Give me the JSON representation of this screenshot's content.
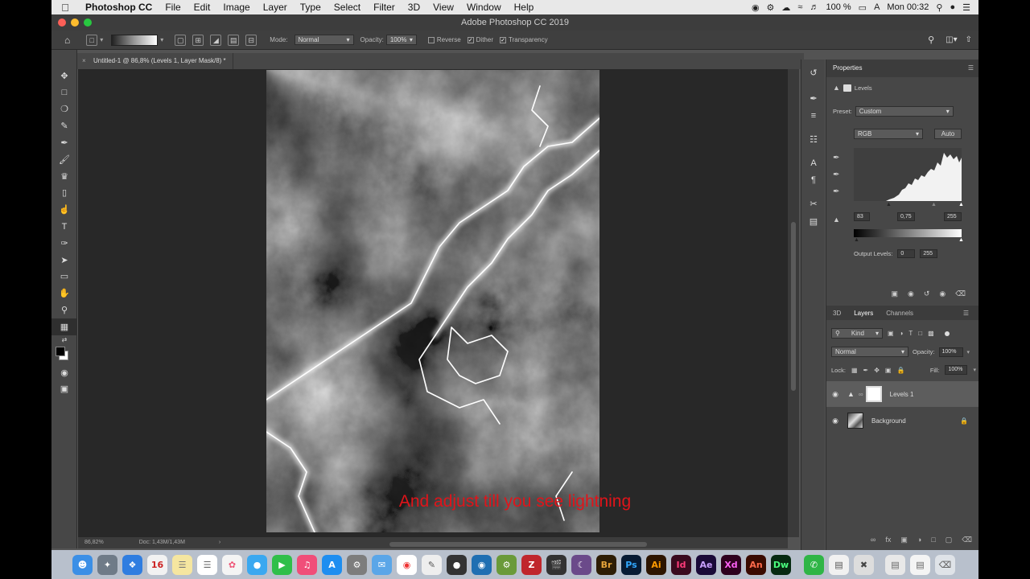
{
  "menubar": {
    "app_name": "Photoshop CC",
    "items": [
      "File",
      "Edit",
      "Image",
      "Layer",
      "Type",
      "Select",
      "Filter",
      "3D",
      "View",
      "Window",
      "Help"
    ],
    "battery": "100 %",
    "clock": "Mon 00:32"
  },
  "window": {
    "title": "Adobe Photoshop CC 2019"
  },
  "options": {
    "mode_label": "Mode:",
    "mode_value": "Normal",
    "opacity_label": "Opacity:",
    "opacity_value": "100%",
    "reverse_label": "Reverse",
    "dither_label": "Dither",
    "transparency_label": "Transparency"
  },
  "document": {
    "tab_title": "Untitled-1 @ 86,8% (Levels 1, Layer Mask/8) *",
    "zoom": "86,82%",
    "doc_size": "Doc: 1,43M/1,43M"
  },
  "properties": {
    "title": "Properties",
    "adjustment": "Levels",
    "preset_label": "Preset:",
    "preset_value": "Custom",
    "channel": "RGB",
    "auto_label": "Auto",
    "input_black": "83",
    "input_mid": "0,75",
    "input_white": "255",
    "output_label": "Output Levels:",
    "output_black": "0",
    "output_white": "255"
  },
  "layers_panel": {
    "tabs": [
      "3D",
      "Layers",
      "Channels"
    ],
    "filter_kind": "Kind",
    "blend_mode": "Normal",
    "opacity_label": "Opacity:",
    "opacity_value": "100%",
    "lock_label": "Lock:",
    "fill_label": "Fill:",
    "fill_value": "100%",
    "layers": [
      {
        "name": "Levels 1"
      },
      {
        "name": "Background"
      }
    ]
  },
  "caption": "And adjust till you see lightning",
  "dock_apps": [
    "Br",
    "Ps",
    "Ai",
    "Id",
    "Ae",
    "Xd",
    "An",
    "Dw"
  ],
  "colors": {
    "caption": "#e0141a",
    "ps_blue": "#31a8ff"
  }
}
